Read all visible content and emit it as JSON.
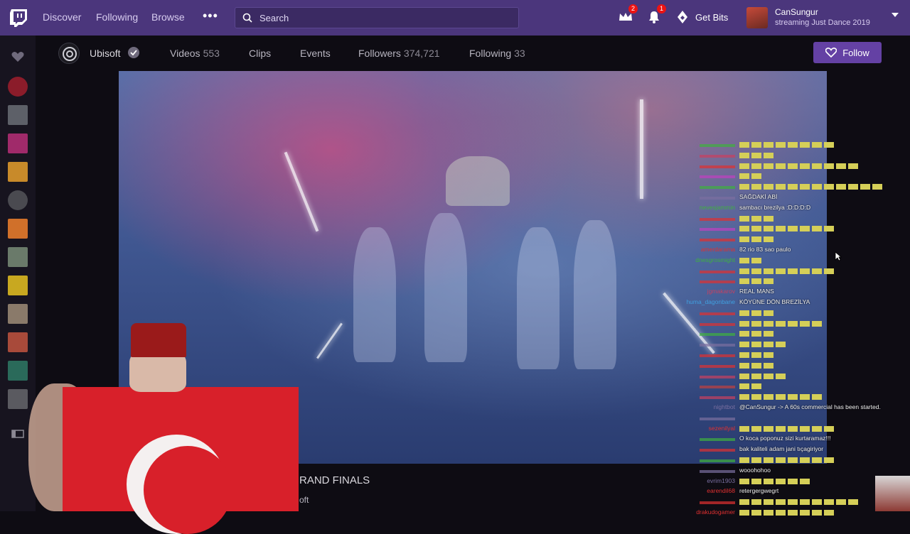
{
  "nav": {
    "discover": "Discover",
    "following": "Following",
    "browse": "Browse",
    "more": "•••",
    "search_placeholder": "Search",
    "prime_badge": "2",
    "notif_badge": "1",
    "get_bits": "Get Bits",
    "user_name": "CanSungur",
    "user_status": "streaming Just Dance 2019"
  },
  "channel": {
    "name": "Ubisoft",
    "tabs": [
      {
        "label": "Videos",
        "count": "553"
      },
      {
        "label": "Clips",
        "count": ""
      },
      {
        "label": "Events",
        "count": ""
      },
      {
        "label": "Followers",
        "count": "374,721"
      },
      {
        "label": "Following",
        "count": "33"
      }
    ],
    "follow_label": "Follow"
  },
  "video": {
    "title_partial": "RAND FINALS",
    "sub_partial": "oft"
  },
  "chat": [
    {
      "user": "",
      "msg": "",
      "emotes": 8,
      "color": "#3fb13f"
    },
    {
      "user": "",
      "msg": "",
      "emotes": 3,
      "color": "#c94060"
    },
    {
      "user": "",
      "msg": "",
      "emotes": 10,
      "color": "#e03030"
    },
    {
      "user": "",
      "msg": "",
      "emotes": 2,
      "color": "#c040c0"
    },
    {
      "user": "",
      "msg": "",
      "emotes": 12,
      "color": "#3fb13f"
    },
    {
      "user": "",
      "msg": "SAĞDAKİ ABİ",
      "emotes": 0,
      "color": "#7a6fa0"
    },
    {
      "user": "nevesjammin",
      "msg": "sambacı brezilya :D:D:D:D",
      "emotes": 0,
      "color": "#3fb13f"
    },
    {
      "user": "",
      "msg": "",
      "emotes": 3,
      "color": "#e03030"
    },
    {
      "user": "",
      "msg": "",
      "emotes": 8,
      "color": "#c040c0"
    },
    {
      "user": "",
      "msg": "",
      "emotes": 3,
      "color": "#e03030"
    },
    {
      "user": "amerdarama",
      "msg": "82 rio 83 sao paulo",
      "emotes": 0,
      "color": "#e03030"
    },
    {
      "user": "dnesgrosmight",
      "msg": "",
      "emotes": 2,
      "color": "#3fb13f"
    },
    {
      "user": "",
      "msg": "",
      "emotes": 8,
      "color": "#e03030"
    },
    {
      "user": "",
      "msg": "",
      "emotes": 3,
      "color": "#e03030"
    },
    {
      "user": "jgmakarov",
      "msg": "REAL MANS",
      "emotes": 0,
      "color": "#c94060"
    },
    {
      "user": "huma_dagonbane",
      "msg": "KÖYÜNE DÖN BREZİLYA",
      "emotes": 0,
      "color": "#3fa0e0"
    },
    {
      "user": "",
      "msg": "",
      "emotes": 3,
      "color": "#e03030"
    },
    {
      "user": "",
      "msg": "",
      "emotes": 7,
      "color": "#e03030"
    },
    {
      "user": "",
      "msg": "",
      "emotes": 3,
      "color": "#3fb13f"
    },
    {
      "user": "",
      "msg": "",
      "emotes": 4,
      "color": "#7a6fa0"
    },
    {
      "user": "",
      "msg": "",
      "emotes": 3,
      "color": "#e03030"
    },
    {
      "user": "",
      "msg": "",
      "emotes": 3,
      "color": "#e03030"
    },
    {
      "user": "",
      "msg": "",
      "emotes": 4,
      "color": "#c94060"
    },
    {
      "user": "",
      "msg": "",
      "emotes": 2,
      "color": "#c04040"
    },
    {
      "user": "",
      "msg": "",
      "emotes": 7,
      "color": "#c94060"
    },
    {
      "user": "nightbot",
      "msg": "@CanSungur -> A 60s commercial has been started.",
      "emotes": 0,
      "color": "#7a6fa0"
    },
    {
      "user": "",
      "msg": "",
      "emotes": 0,
      "color": "#7a6fa0"
    },
    {
      "user": "sezenilyal",
      "msg": "",
      "emotes": 8,
      "color": "#e03030"
    },
    {
      "user": "",
      "msg": "O koca poponuz sizi kurtaramaz!!!",
      "emotes": 0,
      "color": "#3fb13f"
    },
    {
      "user": "",
      "msg": "bak kaliteli adam jani tıçagiriyor",
      "emotes": 0,
      "color": "#e03030"
    },
    {
      "user": "",
      "msg": "",
      "emotes": 8,
      "color": "#3fb13f"
    },
    {
      "user": "",
      "msg": "wooohohoo",
      "emotes": 0,
      "color": "#7a6fa0"
    },
    {
      "user": "evrim1903",
      "msg": "",
      "emotes": 6,
      "color": "#7a6fa0"
    },
    {
      "user": "earendil68",
      "msg": "retergergwegrt",
      "emotes": 0,
      "color": "#e03030"
    },
    {
      "user": "",
      "msg": "",
      "emotes": 10,
      "color": "#e03030"
    },
    {
      "user": "drakudogamer",
      "msg": "",
      "emotes": 8,
      "color": "#e03030"
    }
  ]
}
